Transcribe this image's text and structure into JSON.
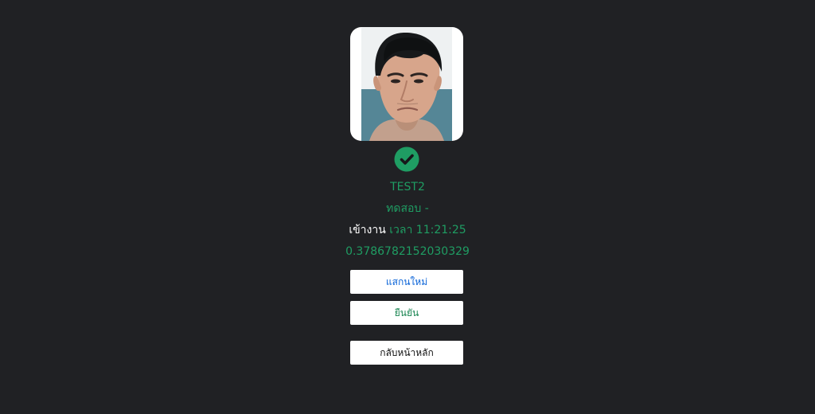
{
  "result": {
    "name": "TEST2",
    "department": "ทดสอบ -",
    "check_type": "เข้างาน",
    "time_label": "เวลา",
    "time_value": "11:21:25",
    "score": "0.3786782152030329"
  },
  "buttons": {
    "rescan": "แสกนใหม่",
    "confirm": "ยืนยัน",
    "home": "กลับหน้าหลัก"
  },
  "icons": {
    "status": "check-circle-icon"
  },
  "colors": {
    "background": "#202124",
    "success": "#1f9d63",
    "rescan_text": "#0b64d8",
    "confirm_text": "#16834f",
    "home_text": "#111111"
  }
}
